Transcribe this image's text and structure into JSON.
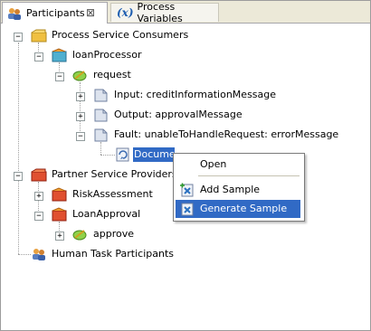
{
  "tabs": [
    {
      "label": "Participants",
      "active": true
    },
    {
      "label": "Process Variables",
      "active": false
    }
  ],
  "tab_close_glyph": "⊠",
  "variables_icon_text": "(x)",
  "tree": {
    "consumers": "Process Service Consumers",
    "loan_processor": "loanProcessor",
    "request": "request",
    "input": "Input: creditInformationMessage",
    "output": "Output: approvalMessage",
    "fault": "Fault: unableToHandleRequest: errorMessage",
    "document": "Documen",
    "providers": "Partner Service Providers",
    "risk": "RiskAssessment",
    "loan_approval": "LoanApproval",
    "approve": "approve",
    "human": "Human Task Participants"
  },
  "context_menu": {
    "items": [
      {
        "label": "Open",
        "icon": "none"
      },
      {
        "label": "Add Sample",
        "icon": "add-sample-icon"
      },
      {
        "label": "Generate Sample",
        "icon": "generate-sample-icon",
        "highlighted": true
      }
    ]
  },
  "colors": {
    "selection": "#316ac5",
    "tab_bar": "#ece9d8"
  }
}
